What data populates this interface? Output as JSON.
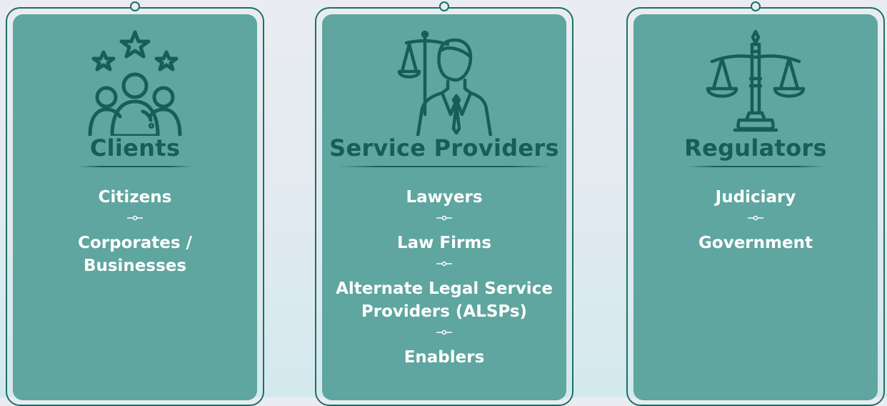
{
  "colors": {
    "panel": "#5ea69f",
    "dark_teal": "#165e56",
    "text": "#ffffff"
  },
  "cards": [
    {
      "title": "Clients",
      "icon": "people-stars-icon",
      "items": [
        "Citizens",
        "Corporates / Businesses"
      ]
    },
    {
      "title": "Service Providers",
      "icon": "lawyer-scales-icon",
      "items": [
        "Lawyers",
        "Law Firms",
        "Alternate Legal Service Providers (ALSPs)",
        "Enablers"
      ]
    },
    {
      "title": "Regulators",
      "icon": "justice-scales-icon",
      "items": [
        "Judiciary",
        "Government"
      ]
    }
  ]
}
